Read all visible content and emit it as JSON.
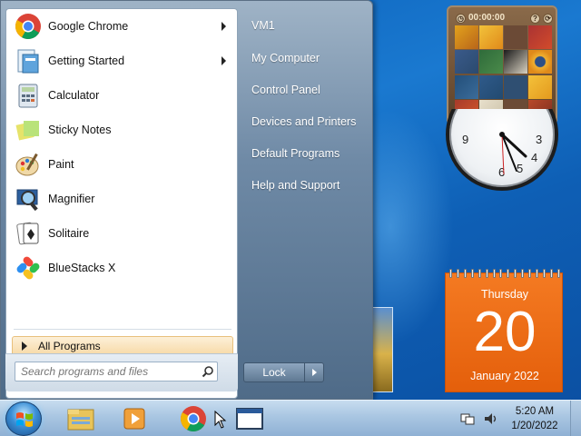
{
  "start_menu": {
    "programs": [
      {
        "label": "Google Chrome",
        "icon": "chrome-icon",
        "has_submenu": true
      },
      {
        "label": "Getting Started",
        "icon": "getting-started-icon",
        "has_submenu": true
      },
      {
        "label": "Calculator",
        "icon": "calculator-icon",
        "has_submenu": false
      },
      {
        "label": "Sticky Notes",
        "icon": "sticky-notes-icon",
        "has_submenu": false
      },
      {
        "label": "Paint",
        "icon": "paint-icon",
        "has_submenu": false
      },
      {
        "label": "Magnifier",
        "icon": "magnifier-icon",
        "has_submenu": false
      },
      {
        "label": "Solitaire",
        "icon": "solitaire-icon",
        "has_submenu": false
      },
      {
        "label": "BlueStacks X",
        "icon": "bluestacks-icon",
        "has_submenu": false
      }
    ],
    "all_programs_label": "All Programs",
    "search_placeholder": "Search programs and files",
    "right_items": [
      "VM1",
      "My Computer",
      "Control Panel",
      "Devices and Printers",
      "Default Programs",
      "Help and Support"
    ],
    "lock_label": "Lock"
  },
  "gadgets": {
    "puzzle_timer": "00:00:00",
    "clock": {
      "numerals": [
        "9",
        "3",
        "6",
        "5",
        "4"
      ]
    },
    "calendar": {
      "day_name": "Thursday",
      "day_number": "20",
      "month_year": "January 2022"
    }
  },
  "taskbar": {
    "time": "5:20 AM",
    "date": "1/20/2022"
  },
  "colors": {
    "desktop": "#1a79d0",
    "calendar": "#f06c17",
    "all_programs_highlight": "#f7d9a6"
  }
}
